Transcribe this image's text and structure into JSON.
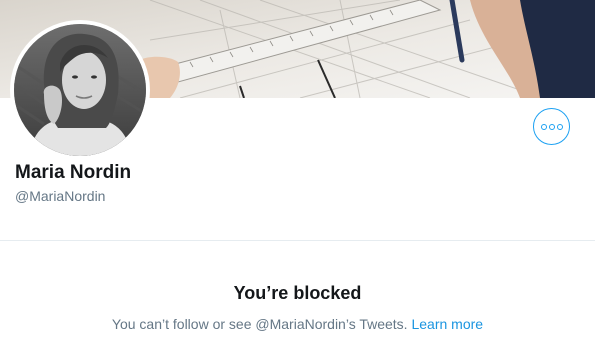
{
  "profile": {
    "display_name": "Maria Nordin",
    "handle": "@MariaNordin"
  },
  "actions": {
    "more_icon": "more-horizontal-icon"
  },
  "blocked": {
    "title": "You’re blocked",
    "message": "You can’t follow or see @MariaNordin’s Tweets.",
    "learn_more": "Learn more"
  },
  "colors": {
    "accent": "#1da1f2",
    "link": "#1b95e0",
    "primary_text": "#14171a",
    "secondary_text": "#657786",
    "divider": "#e6ecf0"
  }
}
